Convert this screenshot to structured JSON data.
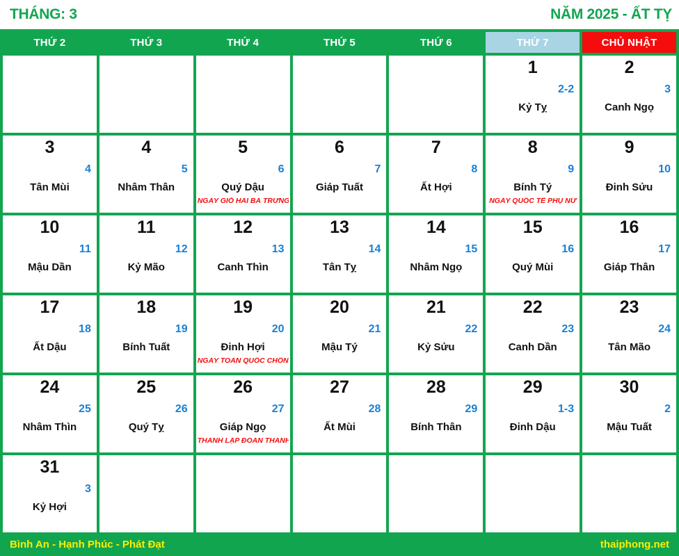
{
  "header": {
    "month_label": "THÁNG: 3",
    "year_label": "NĂM 2025 - ẤT TỴ"
  },
  "colors": {
    "green": "#12a550",
    "red": "#f50c0c",
    "saturday_blue": "#a9d4e4",
    "lunar_blue": "#1a7fd4",
    "footer_yellow": "#ffee00",
    "solar_black": "#111111"
  },
  "weekdays": [
    {
      "label": "THỨ 2",
      "kind": "weekday"
    },
    {
      "label": "THỨ 3",
      "kind": "weekday"
    },
    {
      "label": "THỨ 4",
      "kind": "weekday"
    },
    {
      "label": "THỨ 5",
      "kind": "weekday"
    },
    {
      "label": "THỨ 6",
      "kind": "weekday"
    },
    {
      "label": "THỨ 7",
      "kind": "saturday"
    },
    {
      "label": "CHỦ NHẬT",
      "kind": "sunday"
    }
  ],
  "weeks": [
    [
      {
        "empty": true
      },
      {
        "empty": true
      },
      {
        "empty": true
      },
      {
        "empty": true
      },
      {
        "empty": true
      },
      {
        "solar": "1",
        "lunar": "2-2",
        "canchi": "Kỷ Tỵ",
        "event": ""
      },
      {
        "solar": "2",
        "lunar": "3",
        "canchi": "Canh Ngọ",
        "event": ""
      }
    ],
    [
      {
        "solar": "3",
        "lunar": "4",
        "canchi": "Tân Mùi",
        "event": ""
      },
      {
        "solar": "4",
        "lunar": "5",
        "canchi": "Nhâm Thân",
        "event": ""
      },
      {
        "solar": "5",
        "lunar": "6",
        "canchi": "Quý Dậu",
        "event": "NGÀY GIỖ HAI BÀ TRƯNG"
      },
      {
        "solar": "6",
        "lunar": "7",
        "canchi": "Giáp Tuất",
        "event": ""
      },
      {
        "solar": "7",
        "lunar": "8",
        "canchi": "Ất Hợi",
        "event": ""
      },
      {
        "solar": "8",
        "lunar": "9",
        "canchi": "Bính Tý",
        "event": "NGÀY QUỐC TẾ PHỤ NỮ"
      },
      {
        "solar": "9",
        "lunar": "10",
        "canchi": "Đinh Sửu",
        "event": ""
      }
    ],
    [
      {
        "solar": "10",
        "lunar": "11",
        "canchi": "Mậu Dần",
        "event": ""
      },
      {
        "solar": "11",
        "lunar": "12",
        "canchi": "Kỷ Mão",
        "event": ""
      },
      {
        "solar": "12",
        "lunar": "13",
        "canchi": "Canh Thìn",
        "event": ""
      },
      {
        "solar": "13",
        "lunar": "14",
        "canchi": "Tân Tỵ",
        "event": ""
      },
      {
        "solar": "14",
        "lunar": "15",
        "canchi": "Nhâm Ngọ",
        "event": ""
      },
      {
        "solar": "15",
        "lunar": "16",
        "canchi": "Quý Mùi",
        "event": ""
      },
      {
        "solar": "16",
        "lunar": "17",
        "canchi": "Giáp Thân",
        "event": ""
      }
    ],
    [
      {
        "solar": "17",
        "lunar": "18",
        "canchi": "Ất Dậu",
        "event": ""
      },
      {
        "solar": "18",
        "lunar": "19",
        "canchi": "Bính Tuất",
        "event": ""
      },
      {
        "solar": "19",
        "lunar": "20",
        "canchi": "Đinh Hợi",
        "event": "NGÀY TOÀN QUỐC CHỐNG MỸ"
      },
      {
        "solar": "20",
        "lunar": "21",
        "canchi": "Mậu Tý",
        "event": ""
      },
      {
        "solar": "21",
        "lunar": "22",
        "canchi": "Kỷ Sửu",
        "event": ""
      },
      {
        "solar": "22",
        "lunar": "23",
        "canchi": "Canh Dần",
        "event": ""
      },
      {
        "solar": "23",
        "lunar": "24",
        "canchi": "Tân Mão",
        "event": ""
      }
    ],
    [
      {
        "solar": "24",
        "lunar": "25",
        "canchi": "Nhâm Thìn",
        "event": ""
      },
      {
        "solar": "25",
        "lunar": "26",
        "canchi": "Quý Tỵ",
        "event": ""
      },
      {
        "solar": "26",
        "lunar": "27",
        "canchi": "Giáp Ngọ",
        "event": "THÀNH LẬP ĐOÀN THANH NIÊN"
      },
      {
        "solar": "27",
        "lunar": "28",
        "canchi": "Ất Mùi",
        "event": ""
      },
      {
        "solar": "28",
        "lunar": "29",
        "canchi": "Bính Thân",
        "event": ""
      },
      {
        "solar": "29",
        "lunar": "1-3",
        "canchi": "Đinh Dậu",
        "event": ""
      },
      {
        "solar": "30",
        "lunar": "2",
        "canchi": "Mậu Tuất",
        "event": ""
      }
    ],
    [
      {
        "solar": "31",
        "lunar": "3",
        "canchi": "Kỷ Hợi",
        "event": ""
      },
      {
        "empty": true
      },
      {
        "empty": true
      },
      {
        "empty": true
      },
      {
        "empty": true
      },
      {
        "empty": true
      },
      {
        "empty": true
      }
    ]
  ],
  "footer": {
    "left": "Bình An - Hạnh Phúc - Phát Đạt",
    "right": "thaiphong.net"
  }
}
